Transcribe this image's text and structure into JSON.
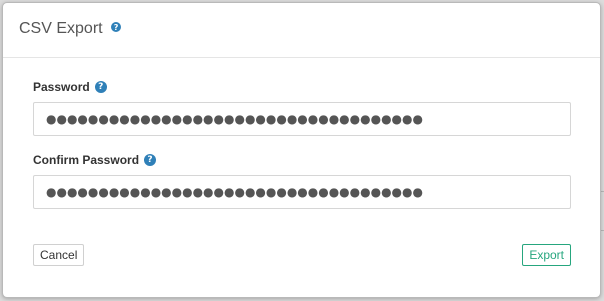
{
  "dialog": {
    "title": "CSV Export",
    "title_help_icon": "question-circle-icon"
  },
  "fields": {
    "password": {
      "label": "Password",
      "value": "●●●●●●●●●●●●●●●●●●●●●●●●●●●●●●●●●●●●",
      "help_icon": "question-circle-icon"
    },
    "confirm_password": {
      "label": "Confirm Password",
      "value": "●●●●●●●●●●●●●●●●●●●●●●●●●●●●●●●●●●●●",
      "help_icon": "question-circle-icon"
    }
  },
  "footer": {
    "cancel_label": "Cancel",
    "export_label": "Export"
  },
  "colors": {
    "accent": "#26a67e",
    "help_icon": "#2f80b8"
  }
}
